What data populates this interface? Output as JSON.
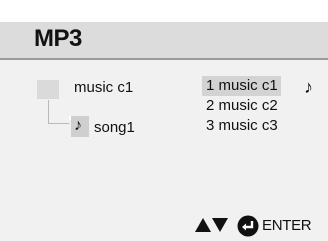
{
  "header": {
    "title": "MP3"
  },
  "tree": {
    "folder": {
      "label": "music c1",
      "icon": "folder-icon"
    },
    "song": {
      "label": "song1",
      "icon": "music-note-icon",
      "note_glyph": "♪"
    }
  },
  "playlist": {
    "items": [
      {
        "label": "1 music c1",
        "selected": true
      },
      {
        "label": "2 music c2",
        "selected": false
      },
      {
        "label": "3 music c3",
        "selected": false
      }
    ],
    "playing_glyph": "♪"
  },
  "footer": {
    "nav_icon": "up-down-arrows-icon",
    "enter_icon": "enter-icon",
    "enter_label": "ENTER"
  }
}
